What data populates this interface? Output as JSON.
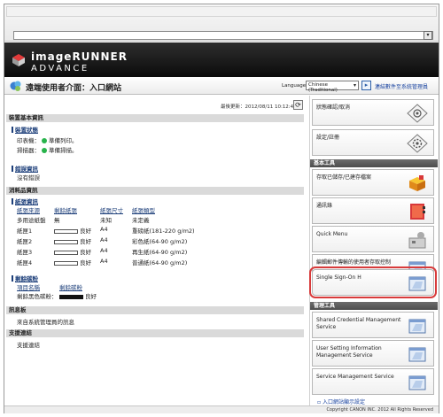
{
  "brand": {
    "line1": "imageRUNNER",
    "line2": "ADVANCE"
  },
  "header": {
    "title": "遠端使用者介面：入口網站",
    "language_label": "Language:",
    "language_value": "Chinese (Traditional)",
    "language_link": "連結數件至系統管理員"
  },
  "main": {
    "last_updated": "最後更新：2012/08/11 10:12:47",
    "device_info": {
      "heading": "裝置基本資訊",
      "status_heading": "裝置狀態",
      "printer_label": "印表機：",
      "printer_status": "準備列印。",
      "scanner_label": "掃描器：",
      "scanner_status": "準備掃描。",
      "error_heading": "錯誤資訊",
      "error_text": "沒有錯誤"
    },
    "consumables": {
      "heading": "消耗品資訊",
      "paper_heading": "紙張資訊",
      "columns": [
        "紙張來源",
        "剩餘紙張",
        "紙張尺寸",
        "紙張類型"
      ],
      "rows": [
        {
          "source": "多用途紙盤",
          "level": "無",
          "size": "未知",
          "type": "未定義",
          "bar": false
        },
        {
          "source": "紙匣1",
          "level": "良好",
          "size": "A4",
          "type": "重磅紙(181-220 g/m2)",
          "bar": true
        },
        {
          "source": "紙匣2",
          "level": "良好",
          "size": "A4",
          "type": "彩色紙(64-90 g/m2)",
          "bar": true
        },
        {
          "source": "紙匣3",
          "level": "良好",
          "size": "A4",
          "type": "再生紙(64-90 g/m2)",
          "bar": true
        },
        {
          "source": "紙匣4",
          "level": "良好",
          "size": "A4",
          "type": "普通紙(64-90 g/m2)",
          "bar": true
        }
      ],
      "toner_heading": "剩餘碳粉",
      "toner_columns": [
        "項目名稱",
        "剩餘碳粉"
      ],
      "toner_name": "剩餘黑色碳粉：",
      "toner_level": "良好"
    },
    "messages": {
      "heading": "訊息板",
      "text": "來自系統管理員的訊息"
    },
    "support": {
      "heading": "支援連結",
      "text": "支援連結"
    }
  },
  "sidebar": {
    "buttons_top": [
      {
        "label": "狀態確認/取消"
      },
      {
        "label": "設定/註冊"
      }
    ],
    "basic_tools_heading": "基本工具",
    "basic_tools": [
      {
        "label": "存取已儲存/已建存檔案"
      },
      {
        "label": "通訊錄"
      },
      {
        "label": "Quick Menu"
      },
      {
        "label": "編輯郵件傳輸的使用者存取控制"
      },
      {
        "label": "Single Sign-On H"
      }
    ],
    "management_heading": "管理工具",
    "management_tools": [
      {
        "label": "Shared Credential Management Service"
      },
      {
        "label": "User Setting Information Management Service"
      },
      {
        "label": "Service Management Service"
      }
    ],
    "portal_link": "入口網站顯示設定"
  },
  "footer": {
    "copyright": "Copyright CANON INC. 2012 All Rights Reserved"
  }
}
